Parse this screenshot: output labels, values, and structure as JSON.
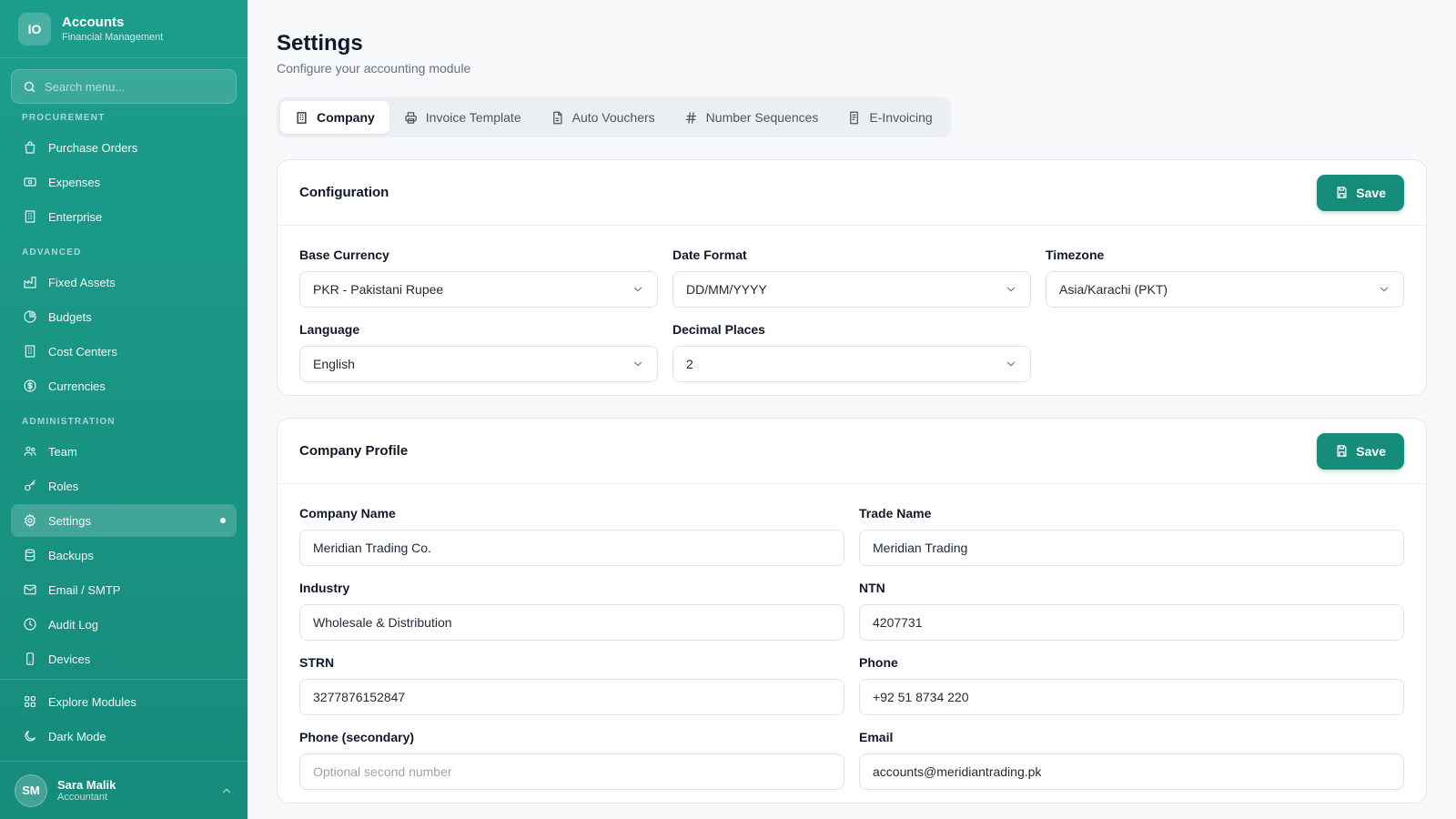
{
  "brand": {
    "initials": "IO",
    "title": "Accounts",
    "subtitle": "Financial Management"
  },
  "search": {
    "placeholder": "Search menu..."
  },
  "sidebar": {
    "sections": [
      {
        "label": "PROCUREMENT",
        "items": [
          "Purchase Orders",
          "Expenses",
          "Enterprise"
        ]
      },
      {
        "label": "ADVANCED",
        "items": [
          "Fixed Assets",
          "Budgets",
          "Cost Centers",
          "Currencies"
        ]
      },
      {
        "label": "ADMINISTRATION",
        "items": [
          "Team",
          "Roles",
          "Settings",
          "Backups",
          "Email / SMTP",
          "Audit Log",
          "Devices"
        ]
      }
    ],
    "footer_items": [
      "Explore Modules",
      "Dark Mode"
    ]
  },
  "user": {
    "initials": "SM",
    "name": "Sara Malik",
    "role": "Accountant"
  },
  "page": {
    "title": "Settings",
    "subtitle": "Configure your accounting module"
  },
  "tabs": [
    "Company",
    "Invoice Template",
    "Auto Vouchers",
    "Number Sequences",
    "E-Invoicing"
  ],
  "config": {
    "title": "Configuration",
    "save_label": "Save",
    "fields": {
      "base_currency": {
        "label": "Base Currency",
        "value": "PKR - Pakistani Rupee"
      },
      "date_format": {
        "label": "Date Format",
        "value": "DD/MM/YYYY"
      },
      "timezone": {
        "label": "Timezone",
        "value": "Asia/Karachi (PKT)"
      },
      "language": {
        "label": "Language",
        "value": "English"
      },
      "decimal_places": {
        "label": "Decimal Places",
        "value": "2"
      }
    }
  },
  "profile": {
    "title": "Company Profile",
    "save_label": "Save",
    "fields": {
      "company_name": {
        "label": "Company Name",
        "value": "Meridian Trading Co."
      },
      "trade_name": {
        "label": "Trade Name",
        "value": "Meridian Trading"
      },
      "industry": {
        "label": "Industry",
        "value": "Wholesale & Distribution"
      },
      "ntn": {
        "label": "NTN",
        "value": "4207731"
      },
      "strn": {
        "label": "STRN",
        "value": "3277876152847"
      },
      "phone": {
        "label": "Phone",
        "value": "+92 51 8734 220"
      },
      "phone_secondary": {
        "label": "Phone (secondary)",
        "value": "",
        "placeholder": "Optional second number"
      },
      "email": {
        "label": "Email",
        "value": "accounts@meridiantrading.pk"
      }
    }
  }
}
